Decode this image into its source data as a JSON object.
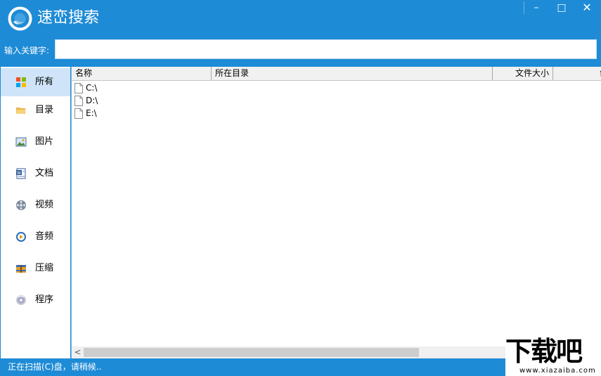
{
  "app": {
    "title": "速峦搜索",
    "window_controls": {
      "minimize": "–",
      "maximize": "□",
      "close": "✕"
    }
  },
  "search": {
    "label": "输入关键字:",
    "value": "",
    "placeholder": ""
  },
  "sidebar": {
    "items": [
      {
        "label": "所有",
        "icon": "all-grid-icon",
        "active": true
      },
      {
        "label": "目录",
        "icon": "folder-icon"
      },
      {
        "label": "图片",
        "icon": "image-icon"
      },
      {
        "label": "文档",
        "icon": "word-document-icon"
      },
      {
        "label": "视频",
        "icon": "film-reel-icon"
      },
      {
        "label": "音频",
        "icon": "audio-disc-icon"
      },
      {
        "label": "压缩",
        "icon": "archive-icon"
      },
      {
        "label": "程序",
        "icon": "program-disc-icon"
      }
    ]
  },
  "table": {
    "columns": [
      "名称",
      "所在目录",
      "文件大小",
      "创建"
    ],
    "rows": [
      {
        "name": "C:\\",
        "dir": "",
        "size": "",
        "created": ""
      },
      {
        "name": "D:\\",
        "dir": "",
        "size": "",
        "created": ""
      },
      {
        "name": "E:\\",
        "dir": "",
        "size": "",
        "created": ""
      }
    ]
  },
  "scrollbar": {
    "left_arrow": "<"
  },
  "status": {
    "text": "正在扫描(C)盘，请稍候.."
  },
  "watermark": {
    "main": "下载吧",
    "sub": "www.xiazaiba.com"
  },
  "colors": {
    "brand": "#1e8bd6",
    "active_item": "#cfe4f8",
    "header_bg": "#f1f1f1"
  }
}
